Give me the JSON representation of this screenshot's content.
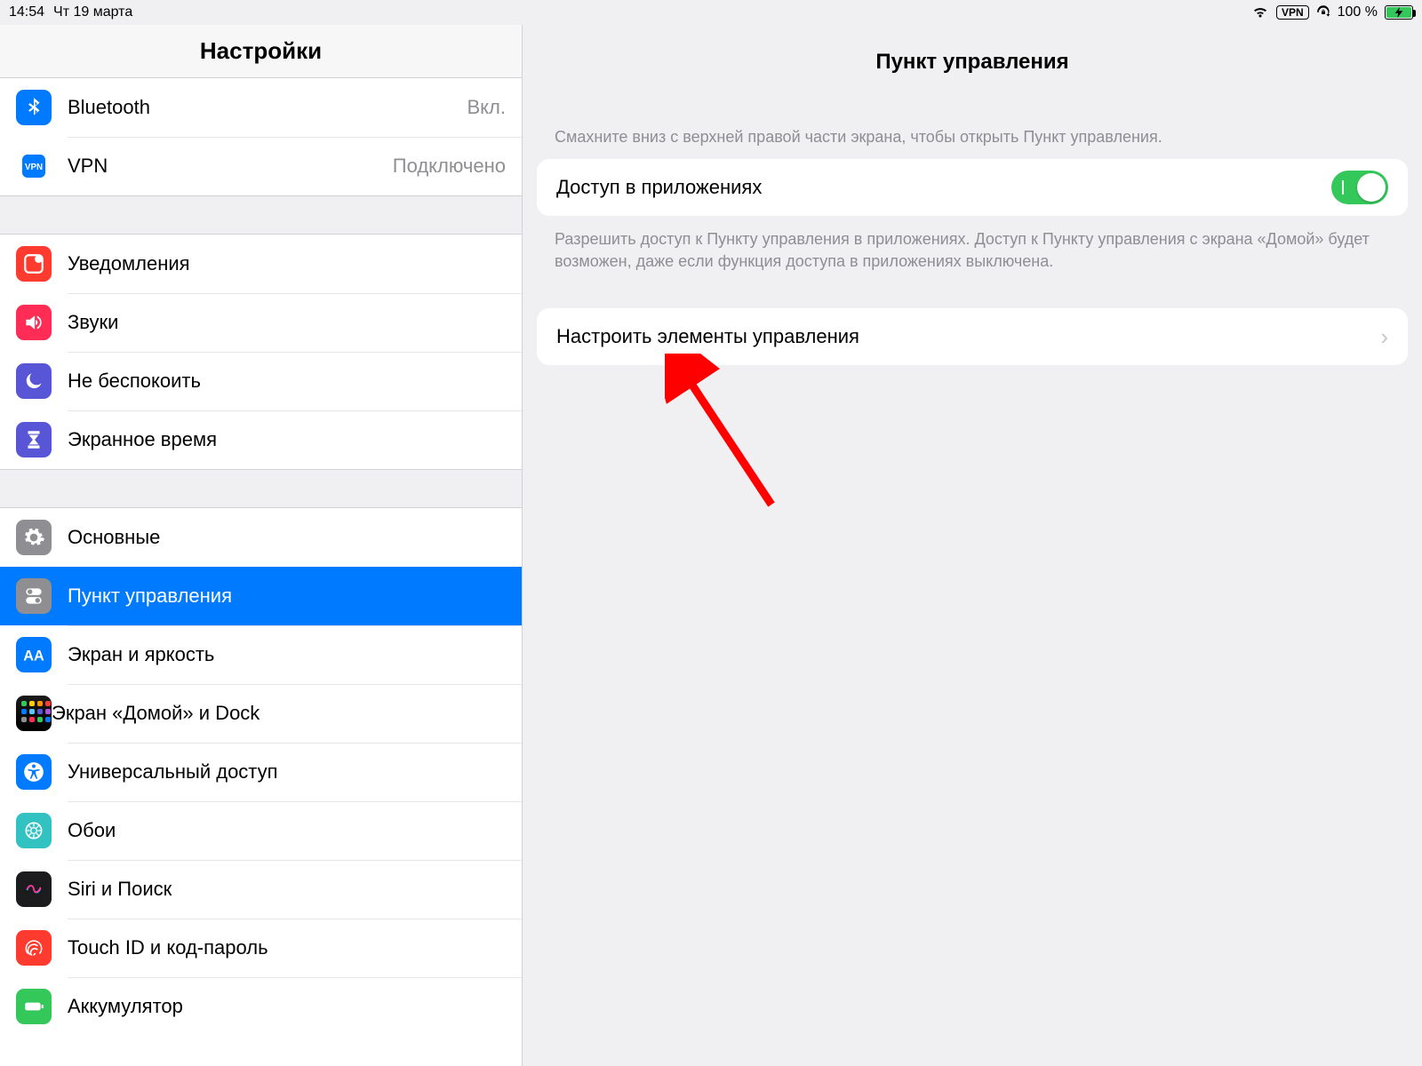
{
  "status": {
    "time": "14:54",
    "date": "Чт 19 марта",
    "vpn_badge": "VPN",
    "battery_pct": "100 %"
  },
  "sidebar": {
    "title": "Настройки",
    "items": [
      {
        "label": "Bluetooth",
        "value": "Вкл.",
        "icon": "bluetooth-icon",
        "color": "#007aff"
      },
      {
        "label": "VPN",
        "value": "Подключено",
        "icon": "vpn-icon",
        "color": "#007aff"
      },
      {
        "label": "Уведомления",
        "value": "",
        "icon": "notifications-icon",
        "color": "#ff3b30"
      },
      {
        "label": "Звуки",
        "value": "",
        "icon": "sounds-icon",
        "color": "#ff2d55"
      },
      {
        "label": "Не беспокоить",
        "value": "",
        "icon": "dnd-icon",
        "color": "#5856d6"
      },
      {
        "label": "Экранное время",
        "value": "",
        "icon": "screentime-icon",
        "color": "#5856d6"
      },
      {
        "label": "Основные",
        "value": "",
        "icon": "general-icon",
        "color": "#8e8e93"
      },
      {
        "label": "Пункт управления",
        "value": "",
        "icon": "controlcenter-icon",
        "color": "#8e8e93",
        "selected": true
      },
      {
        "label": "Экран и яркость",
        "value": "",
        "icon": "display-icon",
        "color": "#007aff"
      },
      {
        "label": "Экран «Домой» и Dock",
        "value": "",
        "icon": "home-dock-icon",
        "color": "#1c1c1e"
      },
      {
        "label": "Универсальный доступ",
        "value": "",
        "icon": "accessibility-icon",
        "color": "#007aff"
      },
      {
        "label": "Обои",
        "value": "",
        "icon": "wallpaper-icon",
        "color": "#33c2c2"
      },
      {
        "label": "Siri и Поиск",
        "value": "",
        "icon": "siri-icon",
        "color": "#1c1c1e"
      },
      {
        "label": "Touch ID и код-пароль",
        "value": "",
        "icon": "touchid-icon",
        "color": "#ff3b30"
      },
      {
        "label": "Аккумулятор",
        "value": "",
        "icon": "battery-icon",
        "color": "#34c759"
      }
    ]
  },
  "detail": {
    "title": "Пункт управления",
    "hint": "Смахните вниз с верхней правой части экрана, чтобы открыть Пункт управления.",
    "access_label": "Доступ в приложениях",
    "access_on": true,
    "access_footer": "Разрешить доступ к Пункту управления в приложениях. Доступ к Пункту управления с экрана «Домой» будет возможен, даже если функция доступа в приложениях выключена.",
    "customize_label": "Настроить элементы управления"
  },
  "annotation": {
    "type": "arrow",
    "color": "#ff0000"
  }
}
